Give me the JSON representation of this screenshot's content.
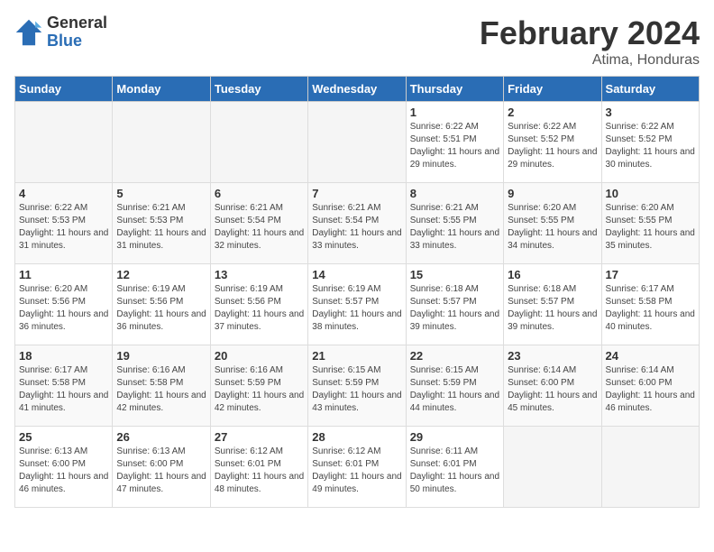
{
  "logo": {
    "general": "General",
    "blue": "Blue"
  },
  "title": "February 2024",
  "subtitle": "Atima, Honduras",
  "days_header": [
    "Sunday",
    "Monday",
    "Tuesday",
    "Wednesday",
    "Thursday",
    "Friday",
    "Saturday"
  ],
  "weeks": [
    [
      {
        "day": "",
        "info": ""
      },
      {
        "day": "",
        "info": ""
      },
      {
        "day": "",
        "info": ""
      },
      {
        "day": "",
        "info": ""
      },
      {
        "day": "1",
        "info": "Sunrise: 6:22 AM\nSunset: 5:51 PM\nDaylight: 11 hours and 29 minutes."
      },
      {
        "day": "2",
        "info": "Sunrise: 6:22 AM\nSunset: 5:52 PM\nDaylight: 11 hours and 29 minutes."
      },
      {
        "day": "3",
        "info": "Sunrise: 6:22 AM\nSunset: 5:52 PM\nDaylight: 11 hours and 30 minutes."
      }
    ],
    [
      {
        "day": "4",
        "info": "Sunrise: 6:22 AM\nSunset: 5:53 PM\nDaylight: 11 hours and 31 minutes."
      },
      {
        "day": "5",
        "info": "Sunrise: 6:21 AM\nSunset: 5:53 PM\nDaylight: 11 hours and 31 minutes."
      },
      {
        "day": "6",
        "info": "Sunrise: 6:21 AM\nSunset: 5:54 PM\nDaylight: 11 hours and 32 minutes."
      },
      {
        "day": "7",
        "info": "Sunrise: 6:21 AM\nSunset: 5:54 PM\nDaylight: 11 hours and 33 minutes."
      },
      {
        "day": "8",
        "info": "Sunrise: 6:21 AM\nSunset: 5:55 PM\nDaylight: 11 hours and 33 minutes."
      },
      {
        "day": "9",
        "info": "Sunrise: 6:20 AM\nSunset: 5:55 PM\nDaylight: 11 hours and 34 minutes."
      },
      {
        "day": "10",
        "info": "Sunrise: 6:20 AM\nSunset: 5:55 PM\nDaylight: 11 hours and 35 minutes."
      }
    ],
    [
      {
        "day": "11",
        "info": "Sunrise: 6:20 AM\nSunset: 5:56 PM\nDaylight: 11 hours and 36 minutes."
      },
      {
        "day": "12",
        "info": "Sunrise: 6:19 AM\nSunset: 5:56 PM\nDaylight: 11 hours and 36 minutes."
      },
      {
        "day": "13",
        "info": "Sunrise: 6:19 AM\nSunset: 5:56 PM\nDaylight: 11 hours and 37 minutes."
      },
      {
        "day": "14",
        "info": "Sunrise: 6:19 AM\nSunset: 5:57 PM\nDaylight: 11 hours and 38 minutes."
      },
      {
        "day": "15",
        "info": "Sunrise: 6:18 AM\nSunset: 5:57 PM\nDaylight: 11 hours and 39 minutes."
      },
      {
        "day": "16",
        "info": "Sunrise: 6:18 AM\nSunset: 5:57 PM\nDaylight: 11 hours and 39 minutes."
      },
      {
        "day": "17",
        "info": "Sunrise: 6:17 AM\nSunset: 5:58 PM\nDaylight: 11 hours and 40 minutes."
      }
    ],
    [
      {
        "day": "18",
        "info": "Sunrise: 6:17 AM\nSunset: 5:58 PM\nDaylight: 11 hours and 41 minutes."
      },
      {
        "day": "19",
        "info": "Sunrise: 6:16 AM\nSunset: 5:58 PM\nDaylight: 11 hours and 42 minutes."
      },
      {
        "day": "20",
        "info": "Sunrise: 6:16 AM\nSunset: 5:59 PM\nDaylight: 11 hours and 42 minutes."
      },
      {
        "day": "21",
        "info": "Sunrise: 6:15 AM\nSunset: 5:59 PM\nDaylight: 11 hours and 43 minutes."
      },
      {
        "day": "22",
        "info": "Sunrise: 6:15 AM\nSunset: 5:59 PM\nDaylight: 11 hours and 44 minutes."
      },
      {
        "day": "23",
        "info": "Sunrise: 6:14 AM\nSunset: 6:00 PM\nDaylight: 11 hours and 45 minutes."
      },
      {
        "day": "24",
        "info": "Sunrise: 6:14 AM\nSunset: 6:00 PM\nDaylight: 11 hours and 46 minutes."
      }
    ],
    [
      {
        "day": "25",
        "info": "Sunrise: 6:13 AM\nSunset: 6:00 PM\nDaylight: 11 hours and 46 minutes."
      },
      {
        "day": "26",
        "info": "Sunrise: 6:13 AM\nSunset: 6:00 PM\nDaylight: 11 hours and 47 minutes."
      },
      {
        "day": "27",
        "info": "Sunrise: 6:12 AM\nSunset: 6:01 PM\nDaylight: 11 hours and 48 minutes."
      },
      {
        "day": "28",
        "info": "Sunrise: 6:12 AM\nSunset: 6:01 PM\nDaylight: 11 hours and 49 minutes."
      },
      {
        "day": "29",
        "info": "Sunrise: 6:11 AM\nSunset: 6:01 PM\nDaylight: 11 hours and 50 minutes."
      },
      {
        "day": "",
        "info": ""
      },
      {
        "day": "",
        "info": ""
      }
    ]
  ]
}
